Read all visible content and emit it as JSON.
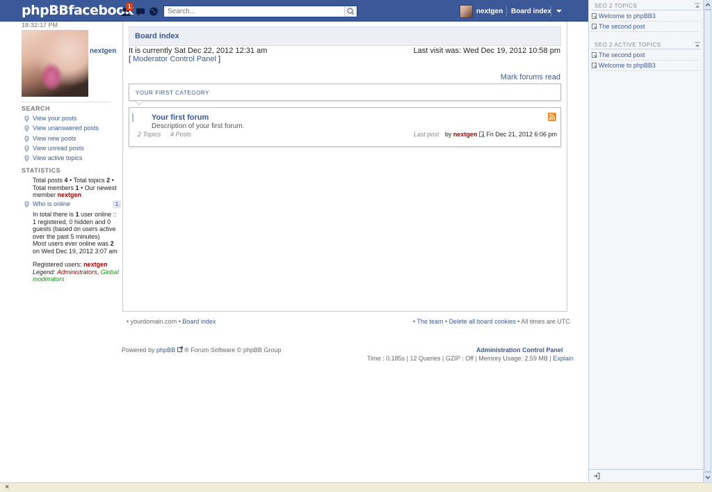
{
  "topbar": {
    "logo": "phpBBfacebook",
    "notification_count": "1",
    "search_placeholder": "Search...",
    "username": "nextgen",
    "board_index": "Board index"
  },
  "sidebar": {
    "clock": "18:32:17 PM",
    "profile_name": "nextgen",
    "search_heading": "SEARCH",
    "search_links": [
      "View your posts",
      "View unanswered posts",
      "View new posts",
      "View unread posts",
      "View active topics"
    ],
    "statistics_heading": "STATISTICS",
    "stats": {
      "total_posts_label": "Total posts",
      "total_posts": "4",
      "total_topics_label": "Total topics",
      "total_topics": "2",
      "total_members_label": "Total members",
      "total_members": "1",
      "newest_member_label": "Our newest member",
      "newest_member": "nextgen"
    },
    "who_is_online": "Who is online",
    "online_count": "1",
    "online_text_1": "In total there is",
    "online_users": "1",
    "online_text_2": "user online :: 1 registered, 0 hidden and 0 guests (based on users active over the past 5 minutes)",
    "most_users_text_1": "Most users ever online was",
    "most_users": "2",
    "most_users_text_2": "on Wed Dec 19, 2012 3:07 am",
    "registered_label": "Registered users:",
    "registered_user": "nextgen",
    "legend_label": "Legend:",
    "legend_admins": "Administrators",
    "legend_gmods": "Global moderators"
  },
  "main": {
    "breadcrumb": "Board index",
    "current_time": "It is currently Sat Dec 22, 2012 12:31 am",
    "last_visit": "Last visit was: Wed Dec 19, 2012 10:58 pm",
    "mcp_open": "[",
    "mcp_link": "Moderator Control Panel",
    "mcp_close": "]",
    "mark_read": "Mark forums read",
    "category_title": "YOUR FIRST CATEGORY",
    "forum": {
      "name": "Your first forum",
      "description": "Description of your first forum.",
      "topics": "2 Topics",
      "posts": "4 Posts",
      "last_post_label": "Last post",
      "last_post_by": "by",
      "last_post_user": "nextgen",
      "last_post_date": "Fri Dec 21, 2012 6:06 pm"
    }
  },
  "footer": {
    "domain": "yourdomain.com",
    "board_index": "Board index",
    "team": "The team",
    "delete_cookies": "Delete all board cookies",
    "timezone": "All times are UTC",
    "powered_by": "Powered by",
    "phpbb": "phpBB",
    "forum_software": "® Forum Software © phpBB Group",
    "acp": "Administration Control Panel",
    "stats": "Time : 0.185s | 12 Queries | GZIP : Off | Memory Usage: 2.59 MB |",
    "explain": "Explain"
  },
  "rightpanel": {
    "seo_topics_heading": "SEO 2 TOPICS",
    "seo_topics": [
      "Welcome to phpBB3",
      "The second post"
    ],
    "seo_active_heading": "SEO 2 ACTIVE TOPICS",
    "seo_active": [
      "The second post",
      "Welcome to phpBB3"
    ]
  },
  "statusbar": {
    "close": "×"
  },
  "colors": {
    "brand": "#3b5998",
    "red_user": "#aa0000",
    "gmod": "#00aa00",
    "rss": "#f58a1f"
  }
}
